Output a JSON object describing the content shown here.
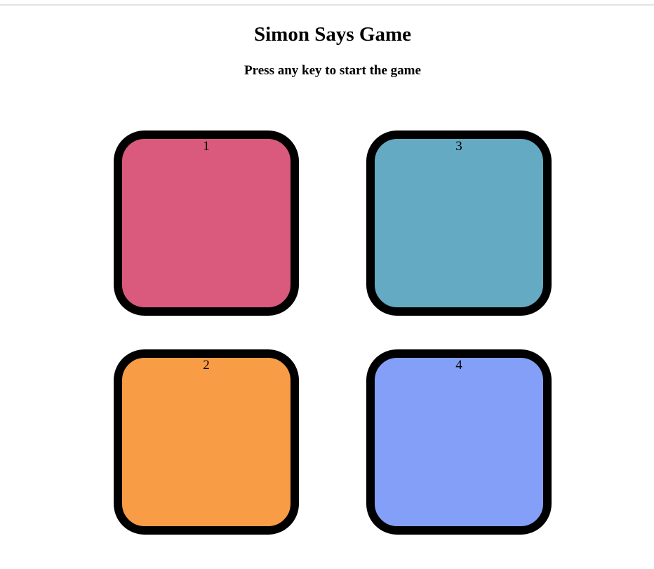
{
  "header": {
    "title": "Simon Says Game",
    "status": "Press any key to start the game"
  },
  "board": {
    "tiles": [
      {
        "label": "1",
        "color": "#d95a7d"
      },
      {
        "label": "3",
        "color": "#64aac2"
      },
      {
        "label": "2",
        "color": "#f99c46"
      },
      {
        "label": "4",
        "color": "#849ff8"
      }
    ]
  },
  "colors": {
    "border": "#000000",
    "background": "#ffffff"
  }
}
